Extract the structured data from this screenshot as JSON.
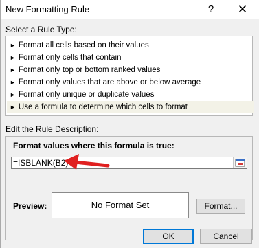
{
  "window": {
    "title": "New Formatting Rule",
    "help_glyph": "?",
    "close_glyph": "✕"
  },
  "rule_type": {
    "label_prefix": "Select a Rule Type:",
    "items": [
      {
        "label": "Format all cells based on their values"
      },
      {
        "label": "Format only cells that contain"
      },
      {
        "label": "Format only top or bottom ranked values"
      },
      {
        "label": "Format only values that are above or below average"
      },
      {
        "label": "Format only unique or duplicate values"
      },
      {
        "label": "Use a formula to determine which cells to format"
      }
    ],
    "bullet": "►",
    "selected_index": 5
  },
  "description": {
    "label": "Edit the Rule Description:",
    "formula_label": "Format values where this formula is true:",
    "formula_value": "=ISBLANK(B2)",
    "preview_label": "Preview:",
    "preview_text": "No Format Set",
    "format_button": "Format..."
  },
  "buttons": {
    "ok": "OK",
    "cancel": "Cancel"
  },
  "colors": {
    "arrow": "#e02020",
    "selected_bg": "#f3f2e7",
    "default_button_border": "#0078d7"
  },
  "icons": {
    "collapse": "collapse-dialog-icon",
    "annotation": "red-arrow-icon"
  }
}
